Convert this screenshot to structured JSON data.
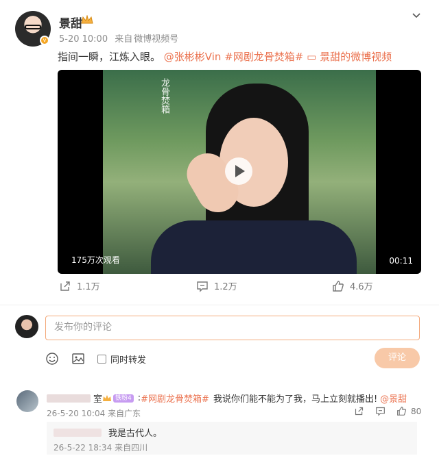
{
  "post": {
    "username": "景甜",
    "time": "5-20 10:00",
    "source_prefix": "来自",
    "source": "微博视频号",
    "text_main": "指间一瞬，江炼入眼。",
    "mention": "@张彬彬Vin",
    "topic": "#网剧龙骨焚箱#",
    "video_link": "景甜的微博视频",
    "video": {
      "views": "175万次观看",
      "duration": "00:11",
      "title_calligraphy": "龙骨焚箱"
    },
    "repost_count": "1.1万",
    "comment_count": "1.2万",
    "like_count": "4.6万"
  },
  "composer": {
    "placeholder": "发布你的评论",
    "forward_label": "同时转发",
    "submit_label": "评论"
  },
  "comments": [
    {
      "name_fragment": "室",
      "level_badge": "铁粉4",
      "topic": "#网剧龙骨焚箱#",
      "text": "我说你们能不能为了我，马上立刻就播出!",
      "mention": "@景甜",
      "time": "26-5-20 10:04",
      "location": "来自广东",
      "likes": "80"
    }
  ],
  "replies": [
    {
      "text": "我是古代人。",
      "time": "26-5-22 18:34",
      "location": "来自四川"
    }
  ],
  "colors": {
    "accent": "#eb7350",
    "submit_bg": "#f8c9a8",
    "input_border": "#f3a87a"
  }
}
